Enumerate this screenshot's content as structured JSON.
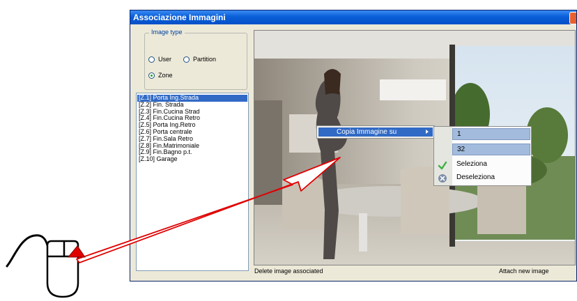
{
  "window": {
    "title": "Associazione Immagini"
  },
  "image_type": {
    "legend": "Image type",
    "options": [
      {
        "label": "User",
        "checked": false
      },
      {
        "label": "Partition",
        "checked": false
      },
      {
        "label": "Zone",
        "checked": true
      }
    ]
  },
  "zones": {
    "items": [
      "[Z.1] Porta Ing.Strada",
      "[Z.2] Fin. Strada",
      "[Z.3] Fin.Cucina Strad",
      "[Z.4] Fin.Cucina Retro",
      "[Z.5] Porta Ing.Retro",
      "[Z.6] Porta centrale",
      "[Z.7] Fin.Sala Retro",
      "[Z.8] Fin.Matrimoniale",
      "[Z.9] Fin.Bagno p.t.",
      "[Z.10] Garage"
    ],
    "selected_index": 0
  },
  "footer": {
    "delete_label": "Delete image associated",
    "attach_label": "Attach new image"
  },
  "context_menu": {
    "item_label": "Copia Immagine su"
  },
  "submenu": {
    "items": [
      {
        "label": "1",
        "icon": "",
        "highlighted": true
      },
      {
        "label": "32",
        "icon": "",
        "highlighted": true
      },
      {
        "label": "Seleziona",
        "icon": "checkmark-icon",
        "highlighted": false
      },
      {
        "label": "Deseleziona",
        "icon": "clear-icon",
        "highlighted": false
      }
    ]
  },
  "colors": {
    "title_bar": "#0a5fd8",
    "selection": "#316ac5",
    "annotation_arrow": "#e00000"
  }
}
